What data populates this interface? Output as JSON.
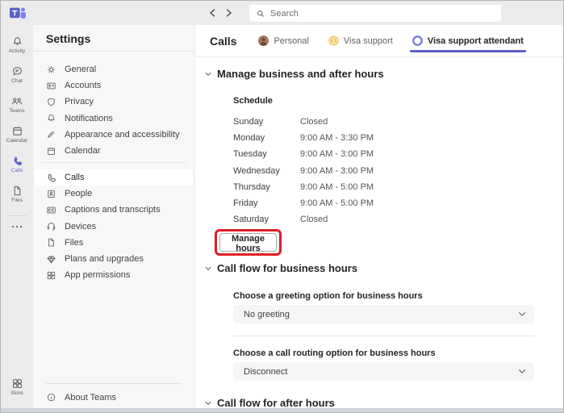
{
  "topbar": {
    "search_placeholder": "Search"
  },
  "rail": {
    "items": [
      {
        "icon": "bell-icon",
        "label": "Activity"
      },
      {
        "icon": "chat-icon",
        "label": "Chat"
      },
      {
        "icon": "people-icon",
        "label": "Teams"
      },
      {
        "icon": "calendar-icon",
        "label": "Calendar"
      },
      {
        "icon": "phone-icon",
        "label": "Calls",
        "active": true
      },
      {
        "icon": "document-icon",
        "label": "Files"
      }
    ],
    "store_label": "Store"
  },
  "settings": {
    "title": "Settings",
    "items": [
      {
        "icon": "gear-icon",
        "label": "General"
      },
      {
        "icon": "id-card-icon",
        "label": "Accounts"
      },
      {
        "icon": "shield-icon",
        "label": "Privacy"
      },
      {
        "icon": "bell-icon",
        "label": "Notifications"
      },
      {
        "icon": "pen-icon",
        "label": "Appearance and accessibility"
      },
      {
        "icon": "calendar-icon",
        "label": "Calendar"
      },
      {
        "icon": "phone-icon",
        "label": "Calls",
        "selected": true
      },
      {
        "icon": "person-badge-icon",
        "label": "People"
      },
      {
        "icon": "captions-icon",
        "label": "Captions and transcripts"
      },
      {
        "icon": "headset-icon",
        "label": "Devices"
      },
      {
        "icon": "document-icon",
        "label": "Files"
      },
      {
        "icon": "diamond-icon",
        "label": "Plans and upgrades"
      },
      {
        "icon": "app-grid-icon",
        "label": "App permissions"
      }
    ],
    "about_label": "About Teams"
  },
  "header": {
    "title": "Calls",
    "tabs": [
      {
        "icon": "avatar",
        "label": "Personal"
      },
      {
        "icon": "call-queue-icon",
        "label": "Visa support"
      },
      {
        "icon": "auto-attendant-icon",
        "label": "Visa support attendant",
        "active": true
      }
    ]
  },
  "main": {
    "section_business_hours": {
      "title": "Manage business and after hours",
      "schedule_title": "Schedule",
      "schedule": [
        {
          "day": "Sunday",
          "hours": "Closed"
        },
        {
          "day": "Monday",
          "hours": "9:00 AM - 3:30 PM"
        },
        {
          "day": "Tuesday",
          "hours": "9:00 AM - 3:00 PM"
        },
        {
          "day": "Wednesday",
          "hours": "9:00 AM - 3:00 PM"
        },
        {
          "day": "Thursday",
          "hours": "9:00 AM - 5:00 PM"
        },
        {
          "day": "Friday",
          "hours": "9:00 AM - 5:00 PM"
        },
        {
          "day": "Saturday",
          "hours": "Closed"
        }
      ],
      "manage_button_label": "Manage hours"
    },
    "section_business_flow": {
      "title": "Call flow for business hours",
      "greeting_label": "Choose a greeting option for business hours",
      "greeting_value": "No greeting",
      "routing_label": "Choose a call routing option for business hours",
      "routing_value": "Disconnect"
    },
    "section_after_flow": {
      "title": "Call flow for after hours"
    }
  },
  "colors": {
    "accent": "#5b5fc7",
    "annotation_red": "#e01e26",
    "rail_bg": "#ebebeb",
    "panel_bg": "#f7f7f7"
  }
}
